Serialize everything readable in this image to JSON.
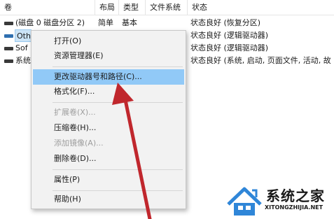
{
  "columns": {
    "volume": "卷",
    "layout": "布局",
    "type": "类型",
    "filesystem": "文件系统",
    "status": "状态"
  },
  "rows": [
    {
      "volume": "(磁盘 0 磁盘分区 2)",
      "layout": "简单",
      "type": "基本",
      "filesystem": "",
      "status": "状态良好 (恢复分区)"
    },
    {
      "volume": "Oth",
      "layout": "",
      "type": "",
      "filesystem": "",
      "status": "状态良好 (逻辑驱动器)"
    },
    {
      "volume": "Sof",
      "layout": "",
      "type": "",
      "filesystem": "",
      "status": "状态良好 (逻辑驱动器)"
    },
    {
      "volume": "系统",
      "layout": "",
      "type": "",
      "filesystem": "",
      "status": "状态良好 (系统, 启动, 页面文件, 活动, 故"
    }
  ],
  "context_menu": {
    "open": "打开(O)",
    "explorer": "资源管理器(E)",
    "change_letter": "更改驱动器号和路径(C)...",
    "format": "格式化(F)...",
    "extend": "扩展卷(X)...",
    "shrink": "压缩卷(H)...",
    "add_mirror": "添加镜像(A)...",
    "delete": "删除卷(D)...",
    "properties": "属性(P)",
    "help": "帮助(H)"
  },
  "watermark": {
    "title": "系统之家",
    "url": "XITONGZHIJIA.NET"
  },
  "colors": {
    "highlight": "#91c9f7",
    "arrow": "#c0272d",
    "menu_bg": "#f2f2f2"
  }
}
